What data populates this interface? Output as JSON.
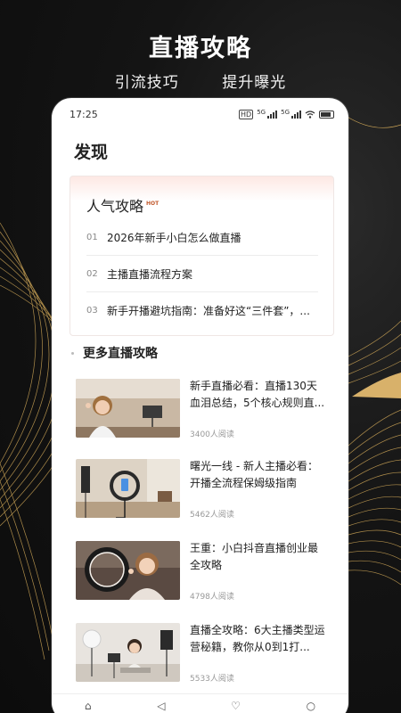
{
  "promo": {
    "title": "直播攻略",
    "subtitle_left": "引流技巧",
    "subtitle_right": "提升曝光"
  },
  "status_bar": {
    "time": "17:25",
    "hd_label": "HD",
    "network_label": "5G"
  },
  "page": {
    "title": "发现"
  },
  "hot_section": {
    "title": "人气攻略",
    "badge": "HOT",
    "items": [
      {
        "num": "01",
        "text": "2026年新手小白怎么做直播"
      },
      {
        "num": "02",
        "text": "主播直播流程方案"
      },
      {
        "num": "03",
        "text": "新手开播避坑指南：准备好这“三件套”，..."
      }
    ]
  },
  "more_section": {
    "title": "更多直播攻略",
    "articles": [
      {
        "title": "新手直播必看：直播130天血泪总结，5个核心规则直...",
        "reads": "3400人阅读",
        "thumb": "girl-waving-phone-tripod"
      },
      {
        "title": "曙光一线 - 新人主播必看：开播全流程保姆级指南",
        "reads": "5462人阅读",
        "thumb": "ring-light-room"
      },
      {
        "title": "王重：小白抖音直播创业最全攻略",
        "reads": "4798人阅读",
        "thumb": "girl-ring-light"
      },
      {
        "title": "直播全攻略：6大主播类型运营秘籍，教你从0到1打...",
        "reads": "5533人阅读",
        "thumb": "studio-setup"
      }
    ]
  },
  "colors": {
    "background": "#121212",
    "hot_badge": "#c25a2e",
    "hot_gradient": "#fde8e3",
    "gold_lines": "#c9a255"
  }
}
